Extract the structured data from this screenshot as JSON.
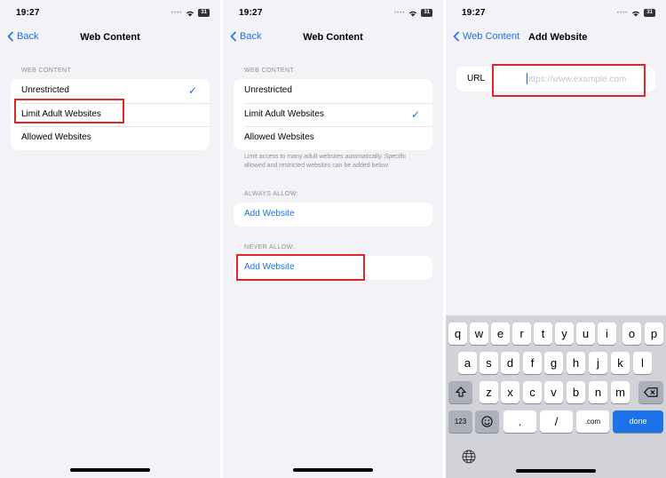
{
  "panels": [
    {
      "status": {
        "time": "19:27",
        "battery": "31"
      },
      "nav": {
        "back_label": "Back",
        "title": "Web Content"
      },
      "section": "WEB CONTENT",
      "items": [
        "Unrestricted",
        "Limit Adult Websites",
        "Allowed Websites"
      ],
      "selected": "Unrestricted"
    },
    {
      "status": {
        "time": "19:27",
        "battery": "31"
      },
      "nav": {
        "back_label": "Back",
        "title": "Web Content"
      },
      "section": "WEB CONTENT",
      "items": [
        "Unrestricted",
        "Limit Adult Websites",
        "Allowed Websites"
      ],
      "selected": "Limit Adult Websites",
      "footnote": "Limit access to many adult websites automatically. Specific allowed and restricted websites can be added below.",
      "always_allow": {
        "label": "ALWAYS ALLOW:",
        "action": "Add Website"
      },
      "never_allow": {
        "label": "NEVER ALLOW:",
        "action": "Add Website"
      }
    },
    {
      "status": {
        "time": "19:27",
        "battery": "31"
      },
      "nav": {
        "back_label": "Web Content",
        "title": "Add Website"
      },
      "url": {
        "label": "URL",
        "placeholder": "https://www.example.com",
        "value": ""
      },
      "keyboard": {
        "row1": [
          "q",
          "w",
          "e",
          "r",
          "t",
          "y",
          "u",
          "i",
          "o",
          "p"
        ],
        "row2": [
          "a",
          "s",
          "d",
          "f",
          "g",
          "h",
          "j",
          "k",
          "l"
        ],
        "row3": [
          "z",
          "x",
          "c",
          "v",
          "b",
          "n",
          "m"
        ],
        "numbers_key": "123",
        "dot_key": ".",
        "slash_key": "/",
        "com_key": ".com",
        "done_key": "done"
      }
    }
  ],
  "colors": {
    "accent": "#1a73e8",
    "highlight": "#e0262d",
    "background": "#f2f2f7"
  },
  "icons": [
    "chevron-left-icon",
    "wifi-icon",
    "battery-icon",
    "checkmark-icon",
    "shift-icon",
    "delete-icon",
    "emoji-icon",
    "globe-icon"
  ]
}
